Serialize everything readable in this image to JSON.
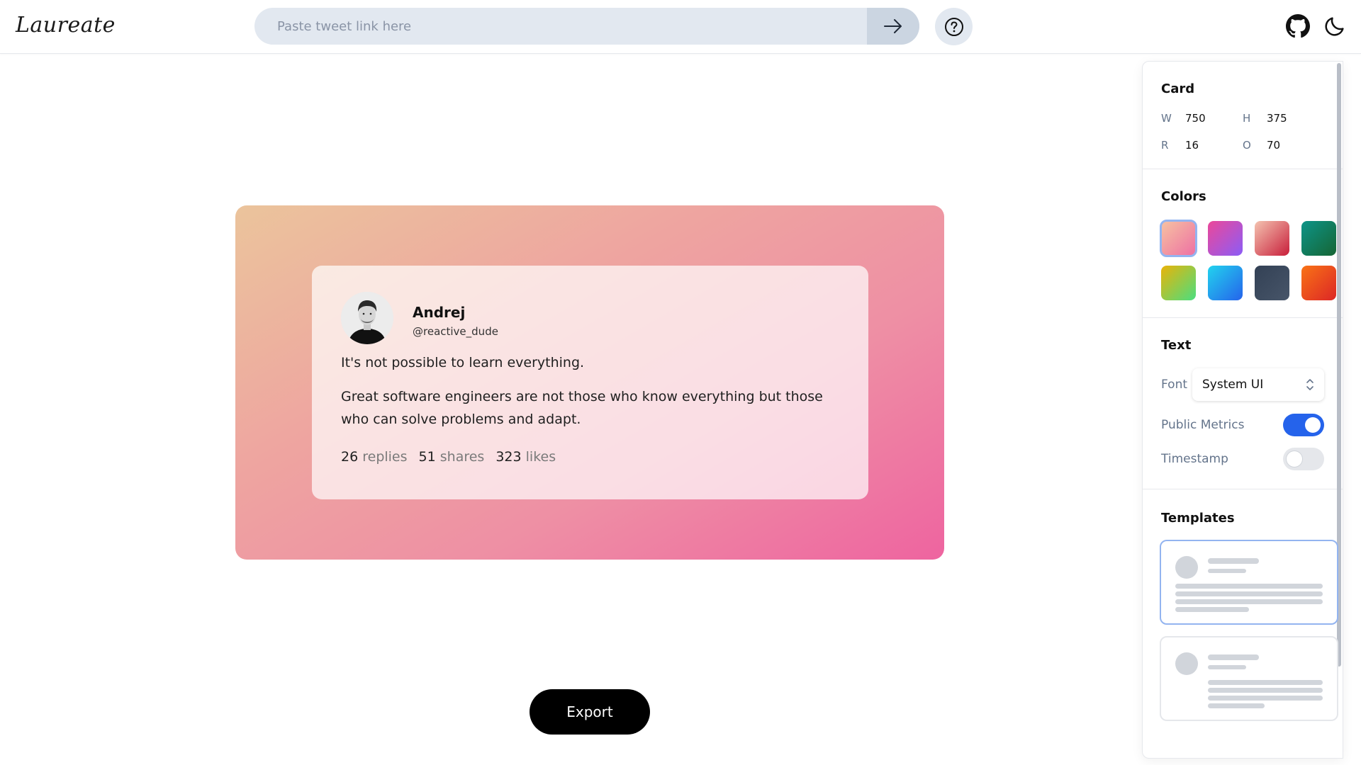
{
  "header": {
    "logo": "Laureate",
    "search": {
      "placeholder": "Paste tweet link here",
      "value": ""
    },
    "icons": {
      "submit": "arrow-right-icon",
      "help": "question-circle-icon",
      "github": "github-icon",
      "theme": "moon-icon"
    }
  },
  "tweet": {
    "author_name": "Andrej",
    "author_handle": "@reactive_dude",
    "paragraphs": [
      "It's not possible to learn everything.",
      "Great software engineers are not those who know everything but those who can solve problems and adapt."
    ],
    "metrics": {
      "replies_count": "26",
      "replies_label": "replies",
      "shares_count": "51",
      "shares_label": "shares",
      "likes_count": "323",
      "likes_label": "likes"
    }
  },
  "export_label": "Export",
  "panel": {
    "card": {
      "title": "Card",
      "w_label": "W",
      "w_value": "750",
      "h_label": "H",
      "h_value": "375",
      "r_label": "R",
      "r_value": "16",
      "o_label": "O",
      "o_value": "70"
    },
    "colors": {
      "title": "Colors",
      "selected_index": 0,
      "swatches": [
        "linear-gradient(135deg,#f6c3a2,#ee6fa3)",
        "linear-gradient(135deg,#ec4899,#8b5cf6)",
        "linear-gradient(135deg,#f4c3b0,#c81e3a)",
        "linear-gradient(135deg,#0d9488,#166534)",
        "linear-gradient(135deg,#eab308,#4ade80)",
        "linear-gradient(135deg,#22d3ee,#2563eb)",
        "linear-gradient(135deg,#334155,#475569)",
        "linear-gradient(135deg,#f97316,#dc2626)"
      ]
    },
    "text": {
      "title": "Text",
      "font_label": "Font",
      "font_value": "System UI",
      "public_metrics_label": "Public Metrics",
      "public_metrics_on": true,
      "timestamp_label": "Timestamp",
      "timestamp_on": false
    },
    "templates": {
      "title": "Templates",
      "selected_index": 0
    }
  }
}
